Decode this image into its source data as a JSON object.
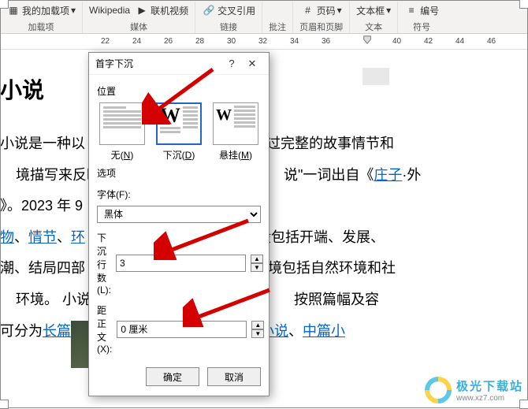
{
  "ribbon": {
    "groups": [
      {
        "label": "加载项",
        "items": [
          "我的加载项"
        ]
      },
      {
        "label": "媒体",
        "items": [
          "Wikipedia",
          "联机视频"
        ]
      },
      {
        "label": "链接",
        "items": [
          "交叉引用"
        ]
      },
      {
        "label": "批注",
        "label_only": true
      },
      {
        "label": "页眉和页脚",
        "items": [
          "页码"
        ]
      },
      {
        "label": "文本",
        "items": [
          "文本框"
        ]
      },
      {
        "label": "符号",
        "items": [
          "编号"
        ]
      }
    ]
  },
  "ruler_ticks": [
    22,
    24,
    26,
    28,
    30,
    32,
    34,
    36,
    40,
    42,
    44,
    46
  ],
  "doc": {
    "heading": "小说",
    "p1a": "小说是一种以",
    "p1b": "过完整的故事情节和",
    "p2a": "境描写来反映",
    "p2b": "说\"一词出自《",
    "p2link": "庄子",
    "p2c": "·外",
    "p3": "》。2023 年 9",
    "p4_links": [
      "物",
      "情节",
      "环"
    ],
    "p4b": "般包括开端、发展、",
    "p5a": "潮、结局四部",
    "p5b": "境包括自然环境和社",
    "p6a": "环境。  小说",
    "p6b": "按照篇幅及容",
    "p7a": "可分为",
    "p7link1": "长篇",
    "p7link2": "小说",
    "p7link3": "中篇小",
    "sep": "、"
  },
  "dialog": {
    "title": "首字下沉",
    "position_label": "位置",
    "opts": [
      {
        "label": "无",
        "key": "N"
      },
      {
        "label": "下沉",
        "key": "D"
      },
      {
        "label": "悬挂",
        "key": "M"
      }
    ],
    "options_label": "选项",
    "font_label": "字体(F):",
    "font_value": "黑体",
    "lines_label": "下沉行数(L):",
    "lines_value": "3",
    "distance_label": "距正文(X):",
    "distance_value": "0 厘米",
    "ok": "确定",
    "cancel": "取消"
  },
  "watermark": {
    "name": "极光下载站",
    "url": "www.xz7.com"
  }
}
